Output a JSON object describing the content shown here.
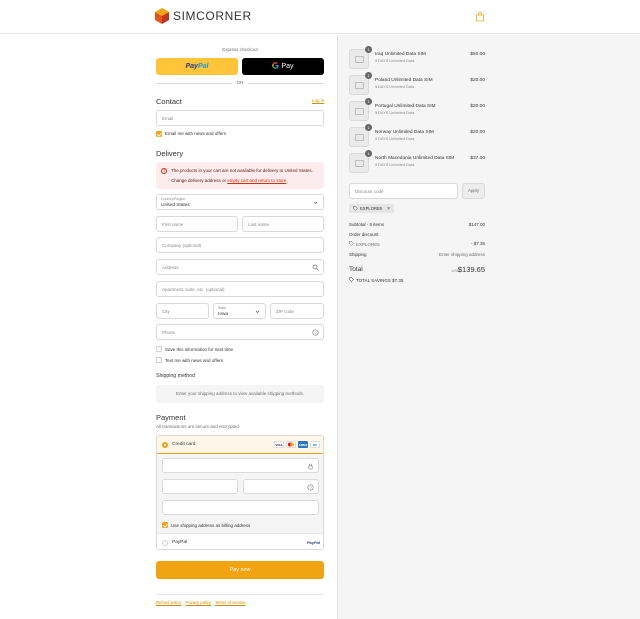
{
  "brand": {
    "name": "SIMCORNER",
    "accent": "#f2a312"
  },
  "express": {
    "label": "Express checkout",
    "paypal_a": "Pay",
    "paypal_b": "Pal",
    "gpay": "Pay",
    "or": "OR"
  },
  "contact": {
    "title": "Contact",
    "login": "Log in",
    "email_placeholder": "Email",
    "newsletter": "Email me with news and offers"
  },
  "delivery": {
    "title": "Delivery",
    "warning_1": "The products in your cart are not available for delivery to United States.",
    "warning_2_prefix": "Change delivery address or ",
    "warning_2_link": "empty cart and return to store",
    "warning_2_suffix": ".",
    "country_label": "Country/Region",
    "country_value": "United States",
    "first_name": "First name",
    "last_name": "Last name",
    "company": "Company (optional)",
    "address": "Address",
    "apartment": "Apartment, suite, etc. (optional)",
    "city": "City",
    "state_label": "State",
    "state_value": "Iowa",
    "zip": "ZIP code",
    "phone": "Phone",
    "save_info": "Save this information for next time",
    "text_me": "Text me with news and offers"
  },
  "shipping_method": {
    "title": "Shipping method",
    "message": "Enter your shipping address to view available shipping methods."
  },
  "payment": {
    "title": "Payment",
    "subtitle": "All transactions are secure and encrypted.",
    "credit_card": "Credit card",
    "cards": [
      "VISA",
      "MC",
      "AMEX",
      "DC"
    ],
    "billing_same": "Use shipping address as billing address",
    "paypal": "PayPal",
    "paypal_logo": "PayPal",
    "pay_now": "Pay now"
  },
  "footer": {
    "refund": "Refund policy",
    "privacy": "Privacy policy",
    "terms": "Terms of service"
  },
  "cart": {
    "items": [
      {
        "name": "Iraq Unlimited Data SIM",
        "sub": "5 DAYS Unlimited Data",
        "price": "$50.00",
        "qty": "1"
      },
      {
        "name": "Poland Unlimited Data SIM",
        "sub": "5 DAYS Unlimited Data",
        "price": "$20.00",
        "qty": "1"
      },
      {
        "name": "Portugal Unlimited Data SIM",
        "sub": "5 DAYS Unlimited Data",
        "price": "$20.00",
        "qty": "1"
      },
      {
        "name": "Norway Unlimited Data SIM",
        "sub": "5 DAYS Unlimited Data",
        "price": "$20.00",
        "qty": "1"
      },
      {
        "name": "North Macedonia Unlimited Data SIM",
        "sub": "5 DAYS Unlimited Data",
        "price": "$37.00",
        "qty": "1"
      }
    ],
    "discount_placeholder": "Discount code",
    "apply": "Apply",
    "applied_code": "EXPLORE5",
    "subtotal_label": "Subtotal · 5 items",
    "subtotal_value": "$147.00",
    "order_discount_label": "Order discount",
    "discount_code": "EXPLORE5",
    "discount_value": "- $7.35",
    "shipping_label": "Shipping",
    "shipping_value": "Enter shipping address",
    "total_label": "Total",
    "currency": "USD",
    "total_value": "$139.65",
    "savings": "TOTAL SAVINGS $7.35"
  }
}
